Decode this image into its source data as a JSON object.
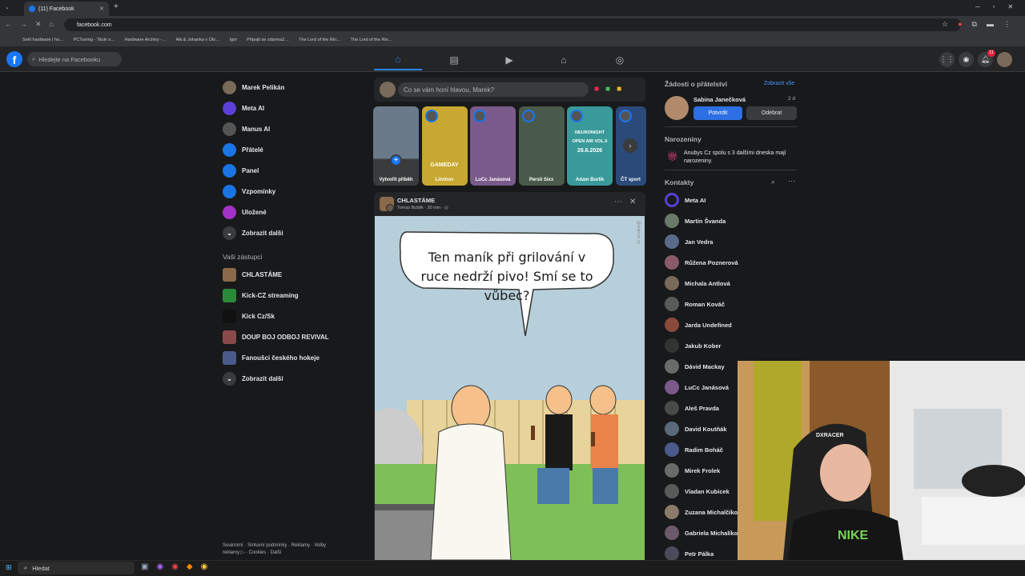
{
  "browser": {
    "tab_title": "(11) Facebook",
    "url": "facebook.com",
    "bookmarks": [
      "Svět hardware | ho…",
      "PCTuning - Tituln s…",
      "Hardware Archivy -…",
      "Aik & Johanka v Olo…",
      "Igor",
      "Připojit se zdarmaZ…",
      "The Lord of the Rin…",
      "The Lord of the Rin…"
    ]
  },
  "fb": {
    "logo": "f",
    "search_placeholder": "Hledejte na Facebooku",
    "notif_count": "11"
  },
  "left": {
    "items": [
      {
        "label": "Marek Pelikán",
        "icon": "avatar",
        "color": "#7a6a5a"
      },
      {
        "label": "Meta AI",
        "icon": "meta-ai-icon",
        "color": "#5b3fd6"
      },
      {
        "label": "Manus AI",
        "icon": "manus-icon",
        "color": "#555"
      },
      {
        "label": "Přátelé",
        "icon": "friends-icon",
        "color": "#1b74e4"
      },
      {
        "label": "Panel",
        "icon": "panel-icon",
        "color": "#1b74e4"
      },
      {
        "label": "Vzpomínky",
        "icon": "memories-icon",
        "color": "#1b74e4"
      },
      {
        "label": "Uložené",
        "icon": "saved-icon",
        "color": "#a333c8"
      },
      {
        "label": "Zobrazit další",
        "icon": "chevron-down-icon",
        "color": "#3a3b3c"
      }
    ],
    "shortcuts_title": "Vaši zástupci",
    "shortcuts": [
      {
        "label": "CHLASTÁME",
        "color": "#8a6a4a"
      },
      {
        "label": "Kick-CZ streaming",
        "color": "#2a8a3a"
      },
      {
        "label": "Kick Cz/Sk",
        "color": "#111"
      },
      {
        "label": "DOUP BOJ ODBOJ REVIVAL",
        "color": "#8a4a4a"
      },
      {
        "label": "Fanoušci českého hokeje",
        "color": "#4a5a8a"
      },
      {
        "label": "Zobrazit další",
        "color": "#3a3b3c"
      }
    ],
    "footer": "Soukromí · Smluvní podmínky · Reklamy · Volby reklamy ▷ · Cookies · Další"
  },
  "composer": {
    "placeholder": "Co se vám honí hlavou, Marek?"
  },
  "stories": [
    {
      "label": "Vytvořit příběh",
      "color": "#6a7a8a"
    },
    {
      "label": "Litvínov",
      "color": "#c8a830"
    },
    {
      "label": "LuCc Janásová",
      "color": "#7a5a8a"
    },
    {
      "label": "Persii Sixx",
      "color": "#4a5a4a"
    },
    {
      "label": "Adam Burlík",
      "color": "#3a9a9a"
    },
    {
      "label": "ČT sport",
      "color": "#2a4a7a"
    }
  ],
  "story_texts": {
    "gameday": "GAMEDAY",
    "bannertop": "NEURONIGHT",
    "bannermid": "OPEN AIR VOL.5",
    "bannerdate": "26.6.2026"
  },
  "post": {
    "group": "CHLASTÁME",
    "author": "Tomas Bublik · 30 min · ◎",
    "bubble": "Ten maník při grilování v ruce nedrží pivo! Smí se to vůbec?",
    "watermark": "@dubcovi.cz"
  },
  "right": {
    "friend_requests_title": "Žádosti o přátelství",
    "see_all": "Zobrazit vše",
    "request_name": "Sabina Janečková",
    "request_time": "2 d",
    "confirm": "Potvrdit",
    "remove": "Odebrat",
    "birthdays_title": "Narozeniny",
    "birthday_text": "Anubys Cz spolu s 3 dalšími dneska mají narozeniny.",
    "contacts_title": "Kontakty",
    "contacts": [
      {
        "name": "Meta AI",
        "color": "#5b3fd6"
      },
      {
        "name": "Martin Švanda",
        "color": "#6a7a6a"
      },
      {
        "name": "Jan Vedra",
        "color": "#5a6a8a"
      },
      {
        "name": "Růžena Poznerová",
        "color": "#8a5a6a"
      },
      {
        "name": "Michala Antlová",
        "color": "#7a6a5a"
      },
      {
        "name": "Roman Kováč",
        "color": "#5a5a5a"
      },
      {
        "name": "Jarda Undefined",
        "color": "#8a4a3a"
      },
      {
        "name": "Jakub Kober",
        "color": "#333"
      },
      {
        "name": "Dávid Mackay",
        "color": "#6a6a6a"
      },
      {
        "name": "LuCc Janásová",
        "color": "#7a5a8a"
      },
      {
        "name": "Aleš Pravda",
        "color": "#4a4a4a"
      },
      {
        "name": "David Koutňák",
        "color": "#5a6a7a"
      },
      {
        "name": "Radim Boháč",
        "color": "#4a5a8a"
      },
      {
        "name": "Mirek Frolek",
        "color": "#6a6a6a"
      },
      {
        "name": "Vladan Kubicek",
        "color": "#5a5a5a"
      },
      {
        "name": "Zuzana Michalčíková",
        "color": "#8a7a6a"
      },
      {
        "name": "Gabriela Michalíková",
        "color": "#6a5a6a"
      },
      {
        "name": "Petr Pálka",
        "color": "#4a4a5a"
      }
    ]
  },
  "webcam": {
    "chair_brand": "DXRACER",
    "shirt_brand": "NIKE"
  },
  "taskbar": {
    "search": "Hledat"
  }
}
